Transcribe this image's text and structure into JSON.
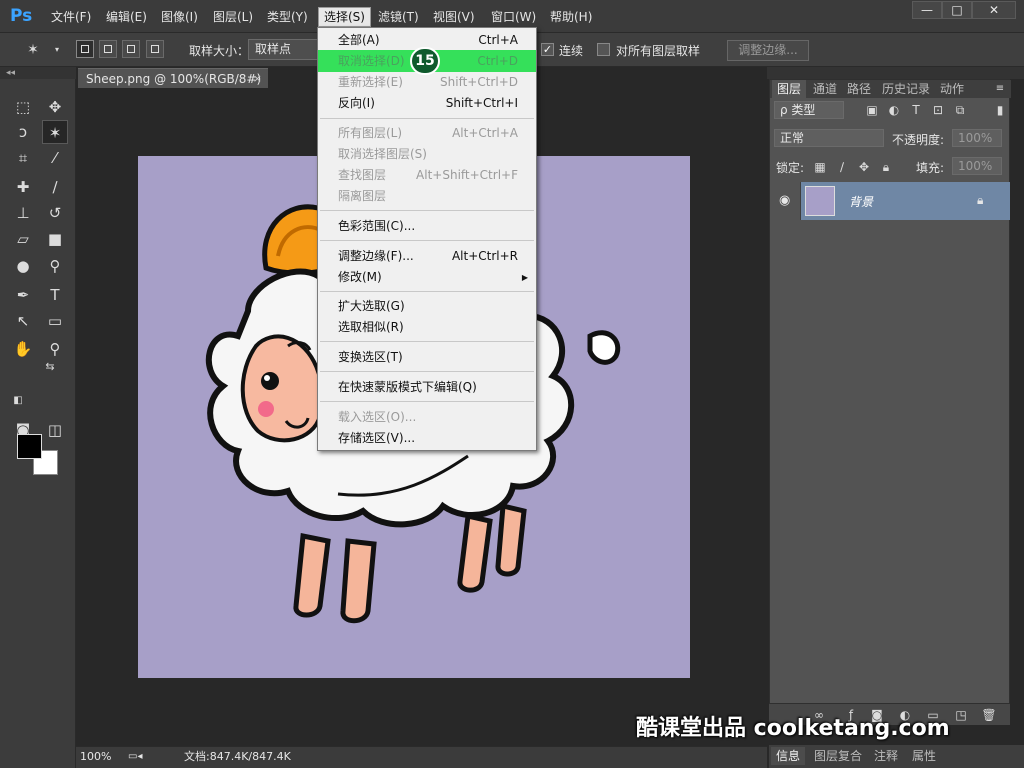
{
  "app": {
    "logo": "Ps"
  },
  "menubar": {
    "items": [
      "文件(F)",
      "编辑(E)",
      "图像(I)",
      "图层(L)",
      "类型(Y)",
      "选择(S)",
      "滤镜(T)",
      "视图(V)",
      "窗口(W)",
      "帮助(H)"
    ],
    "active_index": 5
  },
  "window_controls": {
    "minimize": "—",
    "maximize": "□",
    "close": "✕"
  },
  "options_bar": {
    "sample_size_label": "取样大小：",
    "sample_size_value": "取样点",
    "contiguous_label": "连续",
    "contiguous_checked": true,
    "sample_all_label": "对所有图层取样",
    "sample_all_checked": false,
    "refine_edge_label": "调整边缘..."
  },
  "document": {
    "tab_title": "Sheep.png @ 100%(RGB/8#) *",
    "close_glyph": "×",
    "zoom": "100%",
    "doc_info": "文档:847.4K/847.4K",
    "canvas_color": "#a79fc8"
  },
  "select_menu": {
    "items": [
      {
        "label": "全部(A)",
        "shortcut": "Ctrl+A",
        "enabled": true
      },
      {
        "label": "取消选择(D)",
        "shortcut": "Ctrl+D",
        "enabled": false,
        "highlight": true
      },
      {
        "label": "重新选择(E)",
        "shortcut": "Shift+Ctrl+D",
        "enabled": false
      },
      {
        "label": "反向(I)",
        "shortcut": "Shift+Ctrl+I",
        "enabled": true
      },
      {
        "label": "所有图层(L)",
        "shortcut": "Alt+Ctrl+A",
        "enabled": false
      },
      {
        "label": "取消选择图层(S)",
        "shortcut": "",
        "enabled": false
      },
      {
        "label": "查找图层",
        "shortcut": "Alt+Shift+Ctrl+F",
        "enabled": false
      },
      {
        "label": "隔离图层",
        "shortcut": "",
        "enabled": false
      },
      {
        "label": "色彩范围(C)...",
        "shortcut": "",
        "enabled": true
      },
      {
        "label": "调整边缘(F)...",
        "shortcut": "Alt+Ctrl+R",
        "enabled": true
      },
      {
        "label": "修改(M)",
        "shortcut": "",
        "enabled": true,
        "submenu": true
      },
      {
        "label": "扩大选取(G)",
        "shortcut": "",
        "enabled": true
      },
      {
        "label": "选取相似(R)",
        "shortcut": "",
        "enabled": true
      },
      {
        "label": "变换选区(T)",
        "shortcut": "",
        "enabled": true
      },
      {
        "label": "在快速蒙版模式下编辑(Q)",
        "shortcut": "",
        "enabled": true
      },
      {
        "label": "载入选区(O)...",
        "shortcut": "",
        "enabled": false
      },
      {
        "label": "存储选区(V)...",
        "shortcut": "",
        "enabled": true
      }
    ],
    "highlight_color": "#35e05a",
    "step_badge": "15"
  },
  "layers_panel": {
    "tabs": [
      "图层",
      "通道",
      "路径",
      "历史记录",
      "动作"
    ],
    "active_tab": 0,
    "filter_kind": "ρ 类型",
    "blend_mode": "正常",
    "opacity_label": "不透明度:",
    "opacity_value": "100%",
    "lock_label": "锁定:",
    "fill_label": "填充:",
    "fill_value": "100%",
    "layer_name": "背景",
    "selected_layer_color": "#6f87a5"
  },
  "bottom_panel": {
    "tabs": [
      "信息",
      "图层复合",
      "注释",
      "属性"
    ]
  },
  "watermark": "酷课堂出品 coolketang.com"
}
